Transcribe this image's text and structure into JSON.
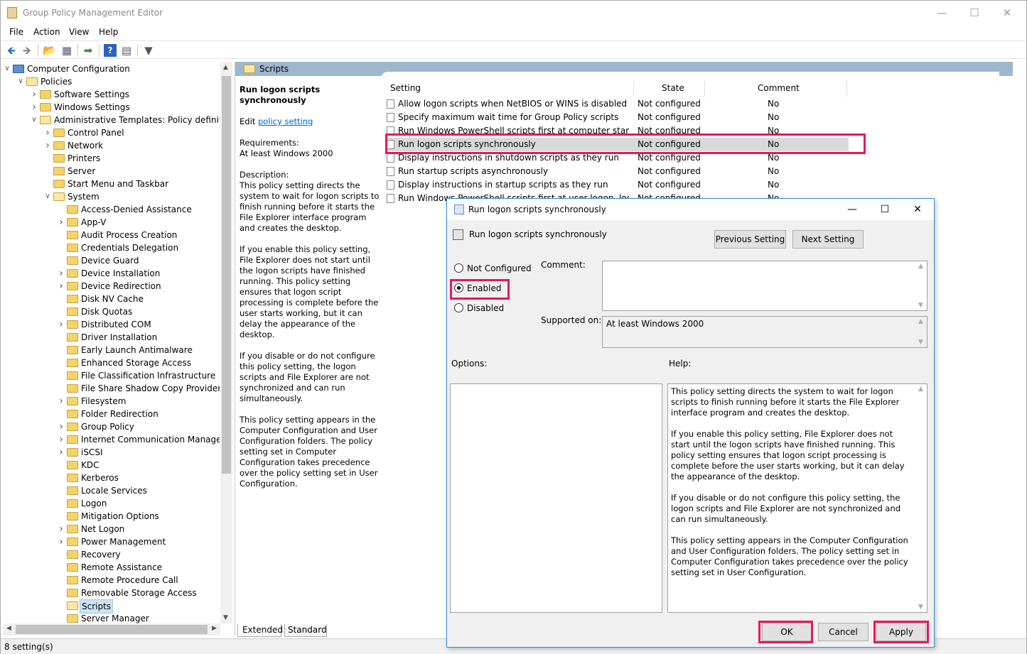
{
  "app": {
    "title": "Group Policy Management Editor"
  },
  "menu": [
    "File",
    "Action",
    "View",
    "Help"
  ],
  "tree": [
    {
      "label": "Computer Configuration",
      "depth": 0,
      "caret": "open",
      "icon": "computer"
    },
    {
      "label": "Policies",
      "depth": 1,
      "caret": "open"
    },
    {
      "label": "Software Settings",
      "depth": 2,
      "caret": "closed"
    },
    {
      "label": "Windows Settings",
      "depth": 2,
      "caret": "closed"
    },
    {
      "label": "Administrative Templates: Policy definitions",
      "depth": 2,
      "caret": "open"
    },
    {
      "label": "Control Panel",
      "depth": 3,
      "caret": "closed"
    },
    {
      "label": "Network",
      "depth": 3,
      "caret": "closed"
    },
    {
      "label": "Printers",
      "depth": 3,
      "caret": ""
    },
    {
      "label": "Server",
      "depth": 3,
      "caret": ""
    },
    {
      "label": "Start Menu and Taskbar",
      "depth": 3,
      "caret": ""
    },
    {
      "label": "System",
      "depth": 3,
      "caret": "open"
    },
    {
      "label": "Access-Denied Assistance",
      "depth": 4,
      "caret": ""
    },
    {
      "label": "App-V",
      "depth": 4,
      "caret": "closed"
    },
    {
      "label": "Audit Process Creation",
      "depth": 4,
      "caret": ""
    },
    {
      "label": "Credentials Delegation",
      "depth": 4,
      "caret": ""
    },
    {
      "label": "Device Guard",
      "depth": 4,
      "caret": ""
    },
    {
      "label": "Device Installation",
      "depth": 4,
      "caret": "closed"
    },
    {
      "label": "Device Redirection",
      "depth": 4,
      "caret": "closed"
    },
    {
      "label": "Disk NV Cache",
      "depth": 4,
      "caret": ""
    },
    {
      "label": "Disk Quotas",
      "depth": 4,
      "caret": ""
    },
    {
      "label": "Distributed COM",
      "depth": 4,
      "caret": "closed"
    },
    {
      "label": "Driver Installation",
      "depth": 4,
      "caret": ""
    },
    {
      "label": "Early Launch Antimalware",
      "depth": 4,
      "caret": ""
    },
    {
      "label": "Enhanced Storage Access",
      "depth": 4,
      "caret": ""
    },
    {
      "label": "File Classification Infrastructure",
      "depth": 4,
      "caret": ""
    },
    {
      "label": "File Share Shadow Copy Provider",
      "depth": 4,
      "caret": ""
    },
    {
      "label": "Filesystem",
      "depth": 4,
      "caret": "closed"
    },
    {
      "label": "Folder Redirection",
      "depth": 4,
      "caret": ""
    },
    {
      "label": "Group Policy",
      "depth": 4,
      "caret": "closed"
    },
    {
      "label": "Internet Communication Management",
      "depth": 4,
      "caret": "closed"
    },
    {
      "label": "iSCSI",
      "depth": 4,
      "caret": "closed"
    },
    {
      "label": "KDC",
      "depth": 4,
      "caret": ""
    },
    {
      "label": "Kerberos",
      "depth": 4,
      "caret": ""
    },
    {
      "label": "Locale Services",
      "depth": 4,
      "caret": ""
    },
    {
      "label": "Logon",
      "depth": 4,
      "caret": ""
    },
    {
      "label": "Mitigation Options",
      "depth": 4,
      "caret": ""
    },
    {
      "label": "Net Logon",
      "depth": 4,
      "caret": "closed"
    },
    {
      "label": "Power Management",
      "depth": 4,
      "caret": "closed"
    },
    {
      "label": "Recovery",
      "depth": 4,
      "caret": ""
    },
    {
      "label": "Remote Assistance",
      "depth": 4,
      "caret": ""
    },
    {
      "label": "Remote Procedure Call",
      "depth": 4,
      "caret": ""
    },
    {
      "label": "Removable Storage Access",
      "depth": 4,
      "caret": ""
    },
    {
      "label": "Scripts",
      "depth": 4,
      "caret": "",
      "selected": true
    },
    {
      "label": "Server Manager",
      "depth": 4,
      "caret": ""
    }
  ],
  "details": {
    "header": "Scripts",
    "title": "Run logon scripts synchronously",
    "edit_prefix": "Edit",
    "edit_link": "policy setting",
    "requirements_label": "Requirements:",
    "requirements_value": "At least Windows 2000",
    "description_label": "Description:",
    "description": [
      "This policy setting directs the system to wait for logon scripts to finish running before it starts the File Explorer interface program and creates the desktop.",
      "If you enable this policy setting, File Explorer does not start until the logon scripts have finished running. This policy setting ensures that logon script processing is complete before the user starts working, but it can delay the appearance of the desktop.",
      "If you disable or do not configure this policy setting, the logon scripts and File Explorer are not synchronized and can run simultaneously.",
      "This policy setting appears in the Computer Configuration and User Configuration folders. The policy setting set in Computer Configuration takes precedence over the policy setting set in User Configuration."
    ]
  },
  "list": {
    "columns": [
      "Setting",
      "State",
      "Comment"
    ],
    "rows": [
      {
        "name": "Allow logon scripts when NetBIOS or WINS is disabled",
        "state": "Not configured",
        "comment": "No"
      },
      {
        "name": "Specify maximum wait time for Group Policy scripts",
        "state": "Not configured",
        "comment": "No"
      },
      {
        "name": "Run Windows PowerShell scripts first at computer startup, shutdown",
        "state": "Not configured",
        "comment": "No"
      },
      {
        "name": "Run logon scripts synchronously",
        "state": "Not configured",
        "comment": "No",
        "selected": true
      },
      {
        "name": "Display instructions in shutdown scripts as they run",
        "state": "Not configured",
        "comment": "No"
      },
      {
        "name": "Run startup scripts asynchronously",
        "state": "Not configured",
        "comment": "No"
      },
      {
        "name": "Display instructions in startup scripts as they run",
        "state": "Not configured",
        "comment": "No"
      },
      {
        "name": "Run Windows PowerShell scripts first at user logon, logoff",
        "state": "Not configured",
        "comment": "No"
      }
    ]
  },
  "tabs": [
    "Extended",
    "Standard"
  ],
  "status": "8 setting(s)",
  "dialog": {
    "title": "Run logon scripts synchronously",
    "heading": "Run logon scripts synchronously",
    "prev_button": "Previous Setting",
    "next_button": "Next Setting",
    "radios": [
      {
        "label": "Not Configured",
        "checked": false
      },
      {
        "label": "Enabled",
        "checked": true
      },
      {
        "label": "Disabled",
        "checked": false
      }
    ],
    "comment_label": "Comment:",
    "comment_value": "",
    "supported_label": "Supported on:",
    "supported_value": "At least Windows 2000",
    "options_label": "Options:",
    "help_label": "Help:",
    "help": [
      "This policy setting directs the system to wait for logon scripts to finish running before it starts the File Explorer interface program and creates the desktop.",
      "If you enable this policy setting, File Explorer does not start until the logon scripts have finished running. This policy setting ensures that logon script processing is complete before the user starts working, but it can delay the appearance of the desktop.",
      "If you disable or do not configure this policy setting, the logon scripts and File Explorer are not synchronized and can run simultaneously.",
      "This policy setting appears in the Computer Configuration and User Configuration folders. The policy setting set in Computer Configuration takes precedence over the policy setting set in User Configuration."
    ],
    "ok_button": "OK",
    "cancel_button": "Cancel",
    "apply_button": "Apply"
  },
  "colors": {
    "highlight": "#e8175d",
    "header_band": "#9eb6ce",
    "selection": "#cde4f7"
  }
}
